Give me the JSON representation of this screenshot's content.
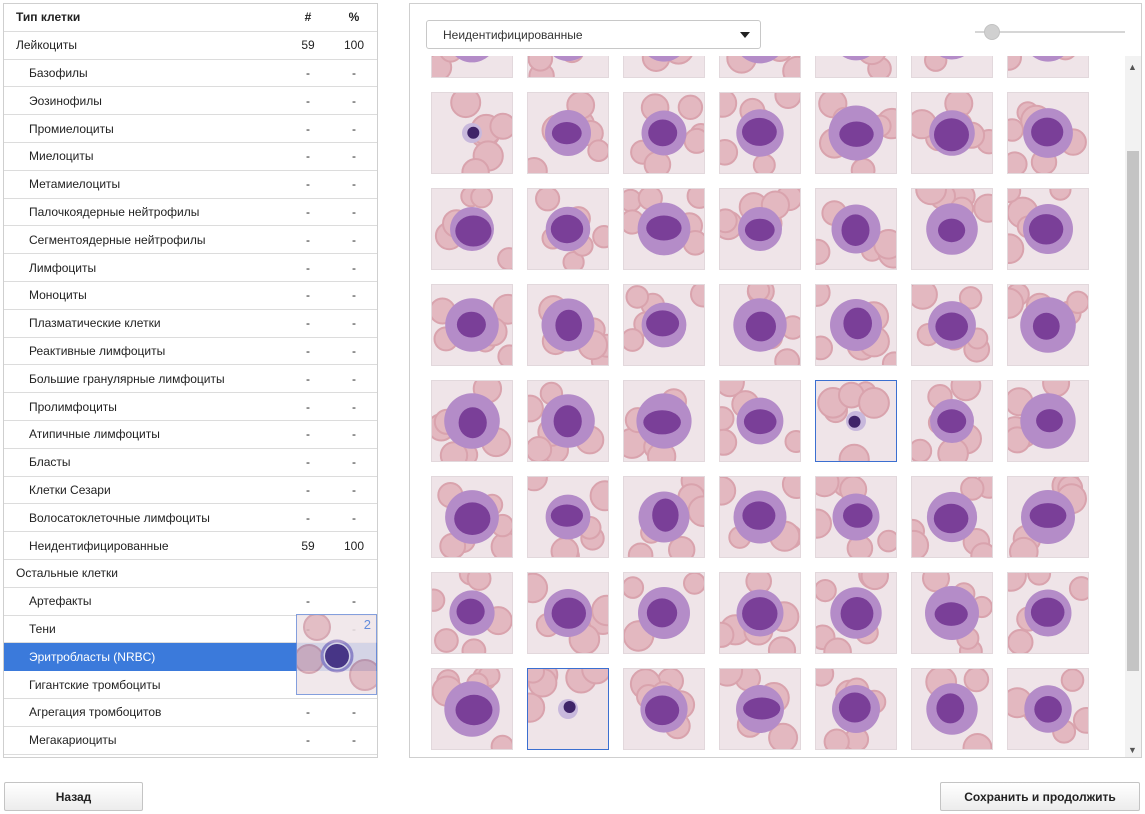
{
  "table": {
    "header": {
      "name": "Тип клетки",
      "count": "#",
      "percent": "%"
    },
    "rows": [
      {
        "name": "Лейкоциты",
        "count": "59",
        "percent": "100",
        "level": 0
      },
      {
        "name": "Базофилы",
        "count": "-",
        "percent": "-",
        "level": 1
      },
      {
        "name": "Эозинофилы",
        "count": "-",
        "percent": "-",
        "level": 1
      },
      {
        "name": "Промиелоциты",
        "count": "-",
        "percent": "-",
        "level": 1
      },
      {
        "name": "Миелоциты",
        "count": "-",
        "percent": "-",
        "level": 1
      },
      {
        "name": "Метамиелоциты",
        "count": "-",
        "percent": "-",
        "level": 1
      },
      {
        "name": "Палочкоядерные нейтрофилы",
        "count": "-",
        "percent": "-",
        "level": 1
      },
      {
        "name": "Сегментоядерные нейтрофилы",
        "count": "-",
        "percent": "-",
        "level": 1
      },
      {
        "name": "Лимфоциты",
        "count": "-",
        "percent": "-",
        "level": 1
      },
      {
        "name": "Моноциты",
        "count": "-",
        "percent": "-",
        "level": 1
      },
      {
        "name": "Плазматические клетки",
        "count": "-",
        "percent": "-",
        "level": 1
      },
      {
        "name": "Реактивные лимфоциты",
        "count": "-",
        "percent": "-",
        "level": 1
      },
      {
        "name": "Большие гранулярные лимфоциты",
        "count": "-",
        "percent": "-",
        "level": 1
      },
      {
        "name": "Пролимфоциты",
        "count": "-",
        "percent": "-",
        "level": 1
      },
      {
        "name": "Атипичные лимфоциты",
        "count": "-",
        "percent": "-",
        "level": 1
      },
      {
        "name": "Бласты",
        "count": "-",
        "percent": "-",
        "level": 1
      },
      {
        "name": "Клетки Сезари",
        "count": "-",
        "percent": "-",
        "level": 1
      },
      {
        "name": "Волосатоклеточные лимфоциты",
        "count": "-",
        "percent": "-",
        "level": 1
      },
      {
        "name": "Неидентифицированные",
        "count": "59",
        "percent": "100",
        "level": 1
      },
      {
        "name": "Остальные клетки",
        "count": "",
        "percent": "",
        "level": 0
      },
      {
        "name": "Артефакты",
        "count": "-",
        "percent": "-",
        "level": 1
      },
      {
        "name": "Тени",
        "count": "-",
        "percent": "-",
        "level": 1
      },
      {
        "name": "Эритробласты (NRBC)",
        "count": "",
        "percent": "",
        "level": 1,
        "selected": true
      },
      {
        "name": "Гигантские тромбоциты",
        "count": "",
        "percent": "",
        "level": 1
      },
      {
        "name": "Агрегация тромбоцитов",
        "count": "-",
        "percent": "-",
        "level": 1
      },
      {
        "name": "Мегакариоциты",
        "count": "-",
        "percent": "-",
        "level": 1
      }
    ]
  },
  "drag_preview": {
    "badge": "2"
  },
  "gallery": {
    "dropdown_value": "Неидентифицированные",
    "zoom_level": 0.1,
    "scroll_fraction": 0.15,
    "columns": 7,
    "rows": 8
  },
  "buttons": {
    "back": "Назад",
    "save_continue": "Сохранить и продолжить"
  },
  "colors": {
    "accent": "#3b7adb",
    "cell_background": "#efe4e8",
    "rbc": "#d9a3ad",
    "nucleus": "#7a3f98",
    "cytoplasm": "#b48cc8"
  },
  "icons": {
    "dropdown": "chevron-down-icon",
    "scroll_up": "scroll-up-icon",
    "scroll_down": "scroll-down-icon"
  }
}
